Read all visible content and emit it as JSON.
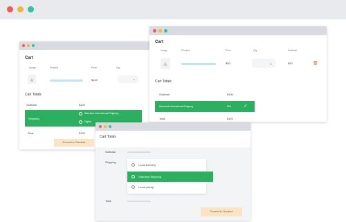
{
  "colors": {
    "red": "#ee5a5a",
    "yellow": "#f4b63d",
    "teal": "#2ec3a7",
    "green": "#2ab05e",
    "orange_button": "#fbe4c4"
  },
  "win_a": {
    "cart_title": "Cart",
    "headers": [
      "Image",
      "Product",
      "Price",
      "Qty"
    ],
    "product_price": "$120",
    "totals_title": "Cart Totals",
    "subtotal_label": "Subtotal",
    "subtotal_value": "$120",
    "shipping_label": "Shipping",
    "shipping_option_1": "Standard International Shipping",
    "shipping_option_2": "Digital",
    "total_label": "Total",
    "total_value": "$120",
    "checkout_label": "Proceed to Checkout"
  },
  "win_b": {
    "cart_title": "Cart",
    "headers": [
      "Image",
      "Product",
      "Price",
      "Qty",
      "Subtotal"
    ],
    "product_price": "$50",
    "product_subtotal": "$50",
    "totals_title": "Cart Totals",
    "subtotal_label": "Subtotal",
    "subtotal_value": "$100",
    "shipping_label": "Standard International Shipping",
    "shipping_value": "$20",
    "total_label": "Total",
    "total_value": "$120"
  },
  "win_c": {
    "totals_title": "Cart Totals",
    "subtotal_label": "Subtotal",
    "shipping_label": "Shipping",
    "option_local": "Local Delivery",
    "option_standard": "Standard Shipping",
    "option_pickup": "Local pickup",
    "total_label": "Total",
    "checkout_label": "Proceed to Checkout"
  },
  "icons": {
    "trash": "trash-icon",
    "check": "check-circle-icon",
    "chevron": "chevron-down-icon",
    "shirt": "shirt-icon"
  }
}
